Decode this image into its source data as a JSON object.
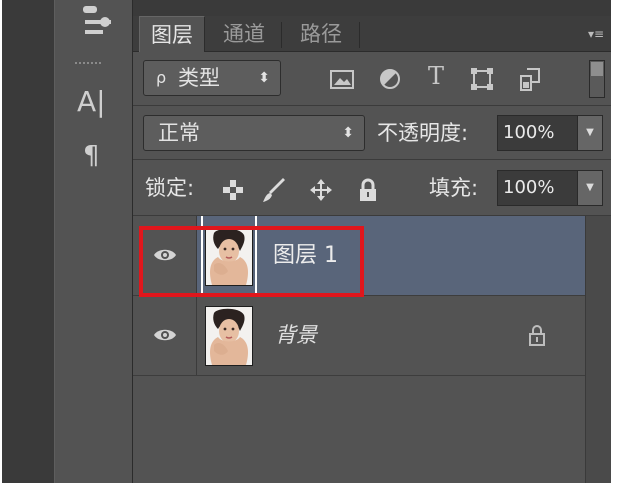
{
  "tabs": [
    {
      "label": "图层",
      "active": true
    },
    {
      "label": "通道",
      "active": false
    },
    {
      "label": "路径",
      "active": false
    }
  ],
  "panel_menu": "▾≡",
  "filter": {
    "search_icon": "ρ",
    "value": "类型",
    "arrows": "⬍"
  },
  "filter_icons": [
    "image-filter-icon",
    "adjustment-filter-icon",
    "type-filter-icon",
    "shape-filter-icon",
    "smart-object-filter-icon"
  ],
  "type_filter_glyph": "T",
  "blend": {
    "value": "正常",
    "arrows": "⬍"
  },
  "opacity": {
    "label": "不透明度:",
    "value": "100%",
    "drop": "▼"
  },
  "lock": {
    "label": "锁定:"
  },
  "fill": {
    "label": "填充:",
    "value": "100%",
    "drop": "▼"
  },
  "tools": {
    "character": "A|",
    "paragraph": "¶"
  },
  "layers": [
    {
      "name": "图层 1",
      "selected": true,
      "locked": false
    },
    {
      "name": "背景",
      "selected": false,
      "locked": true
    }
  ],
  "colors": {
    "panel_bg": "#535353",
    "selected_layer": "#59657a",
    "highlight_border": "#e0161c"
  }
}
